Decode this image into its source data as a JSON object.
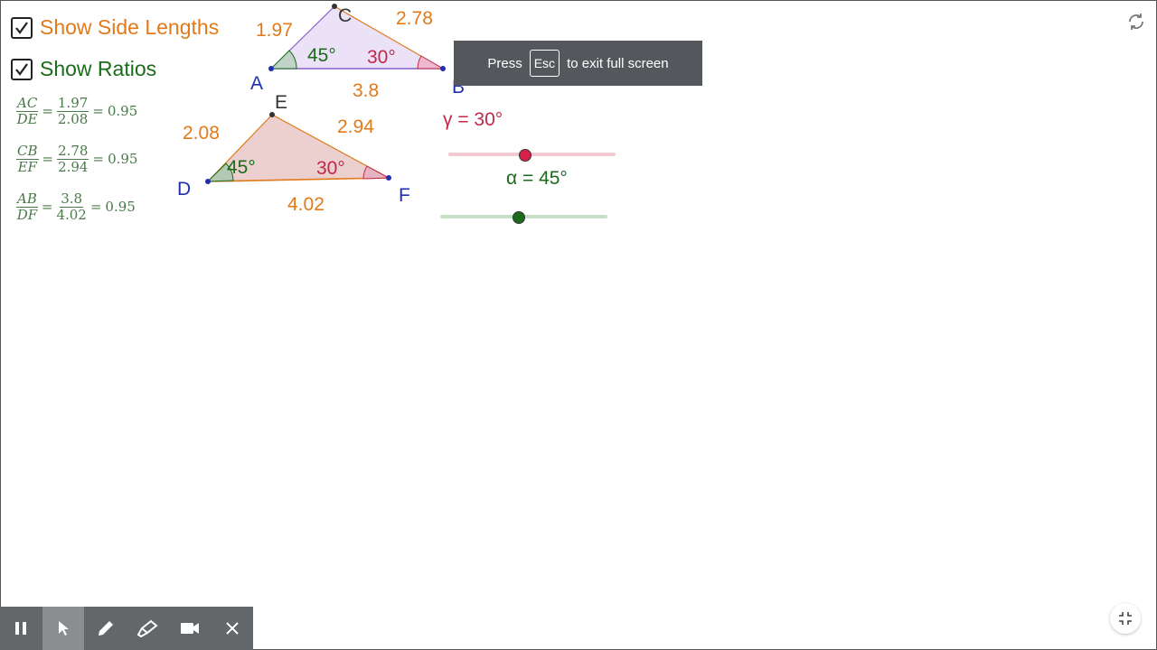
{
  "checkboxes": {
    "side_lengths": {
      "label": "Show Side Lengths",
      "checked": true,
      "color": "#e07a1a"
    },
    "ratios": {
      "label": "Show Ratios",
      "checked": true,
      "color": "#1a6b1a"
    }
  },
  "ratios": [
    {
      "num": "AC",
      "den": "DE",
      "num_val": "1.97",
      "den_val": "2.08",
      "result": "0.95"
    },
    {
      "num": "CB",
      "den": "EF",
      "num_val": "2.78",
      "den_val": "2.94",
      "result": "0.95"
    },
    {
      "num": "AB",
      "den": "DF",
      "num_val": "3.8",
      "den_val": "4.02",
      "result": "0.95"
    }
  ],
  "triangle_abc": {
    "vertices": {
      "a": "A",
      "b": "B",
      "c": "C"
    },
    "sides": {
      "ac": "1.97",
      "cb": "2.78",
      "ab": "3.8"
    },
    "angles": {
      "a": "45°",
      "b": "30°"
    }
  },
  "triangle_def": {
    "vertices": {
      "d": "D",
      "e": "E",
      "f": "F"
    },
    "sides": {
      "de": "2.08",
      "ef": "2.94",
      "df": "4.02"
    },
    "angles": {
      "d": "45°",
      "f": "30°"
    }
  },
  "colors": {
    "side_label": "#e07a1a",
    "angle_alpha": "#1a6b1a",
    "angle_gamma": "#c0284a",
    "vertex": "#1f2fb0"
  },
  "sliders": {
    "gamma": {
      "label": "γ = 30°",
      "value": 30,
      "color": "#c0284a"
    },
    "alpha": {
      "label": "α = 45°",
      "value": 45,
      "color": "#1a6b1a"
    }
  },
  "toast": {
    "press": "Press",
    "key": "Esc",
    "suffix": "to exit full screen"
  },
  "toolbar": {
    "items": [
      "pause-icon",
      "pointer-icon",
      "pen-icon",
      "highlighter-icon",
      "video-camera-icon",
      "close-icon"
    ],
    "active": "pointer-icon"
  },
  "corner_icons": [
    "refresh-icon",
    "exit-fullscreen-icon"
  ]
}
